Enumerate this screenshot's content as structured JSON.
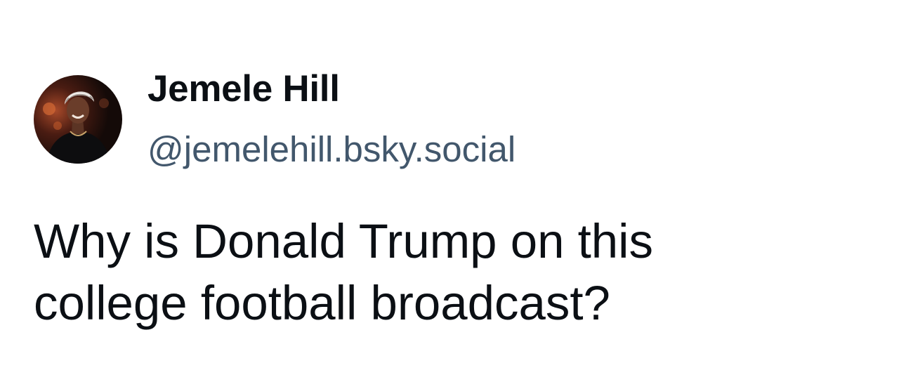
{
  "author": {
    "display_name": "Jemele Hill",
    "handle": "@jemelehill.bsky.social",
    "avatar_icon": "profile-photo-avatar"
  },
  "post": {
    "lines": [
      "Why is Donald Trump on this",
      "college football broadcast?"
    ]
  },
  "colors": {
    "background": "#ffffff",
    "name_text": "#0b0f14",
    "handle_text": "#42576c",
    "body_text": "#0b0f14"
  }
}
